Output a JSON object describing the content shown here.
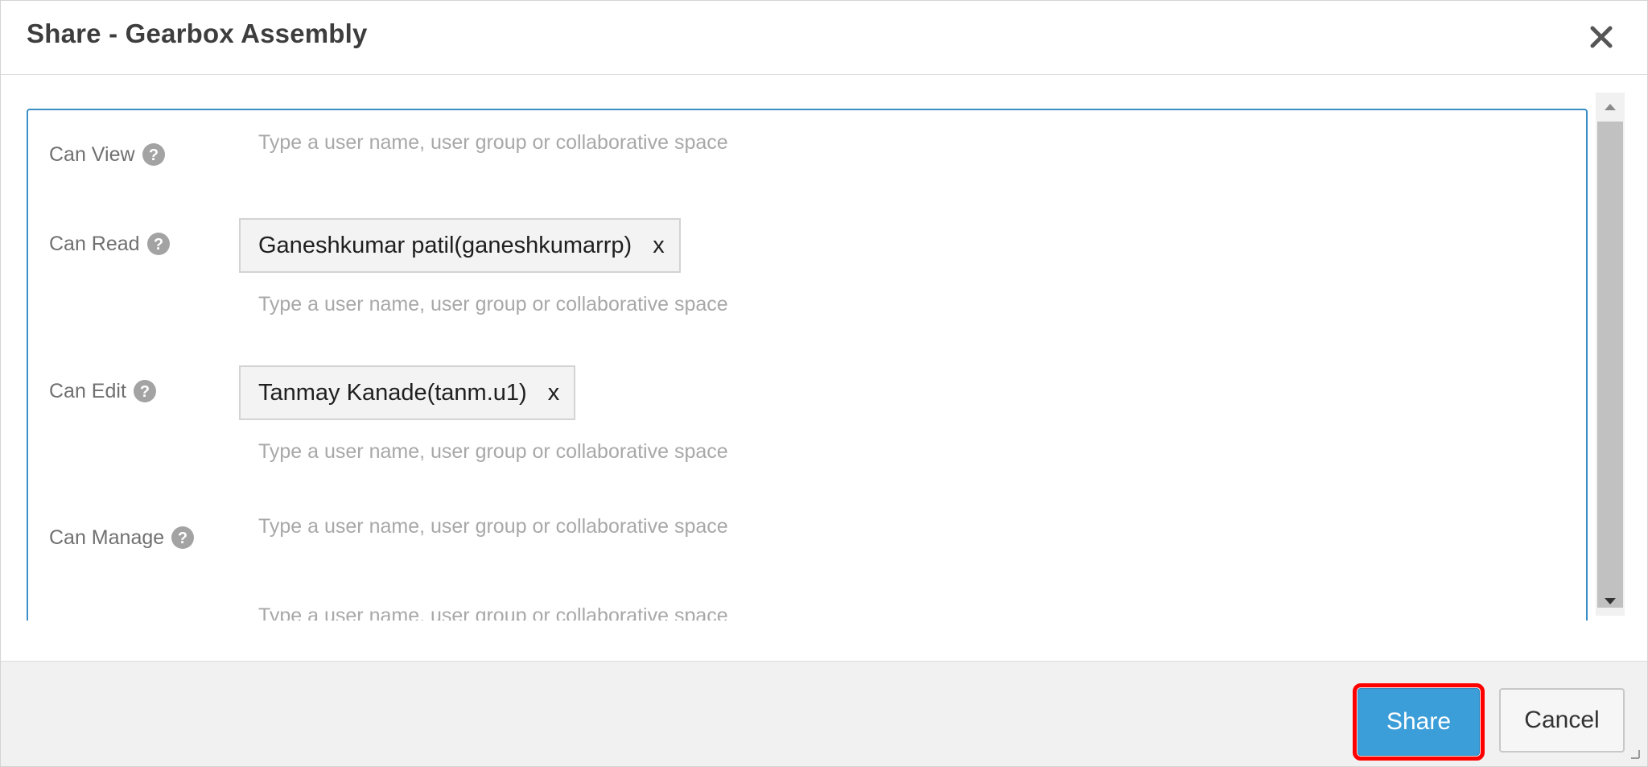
{
  "dialog": {
    "title": "Share - Gearbox Assembly",
    "close_icon": "close-icon"
  },
  "permissions": [
    {
      "label": "Can View",
      "placeholder": "Type a user name, user group or collaborative space",
      "members": []
    },
    {
      "label": "Can Read",
      "placeholder": "Type a user name, user group or collaborative space",
      "members": [
        {
          "name": "Ganeshkumar patil(ganeshkumarrp)",
          "remove": "x"
        }
      ]
    },
    {
      "label": "Can Edit",
      "placeholder": "Type a user name, user group or collaborative space",
      "members": [
        {
          "name": "Tanmay Kanade(tanm.u1)",
          "remove": "x"
        }
      ]
    },
    {
      "label": "Can Manage",
      "placeholder": "Type a user name, user group or collaborative space",
      "members": []
    },
    {
      "label": "",
      "placeholder": "Type a user name, user group or collaborative space",
      "members": []
    }
  ],
  "footer": {
    "share_label": "Share",
    "cancel_label": "Cancel"
  },
  "colors": {
    "accent": "#3c9ed8",
    "panel_border": "#3a8fc7",
    "highlight": "#ff0000"
  }
}
